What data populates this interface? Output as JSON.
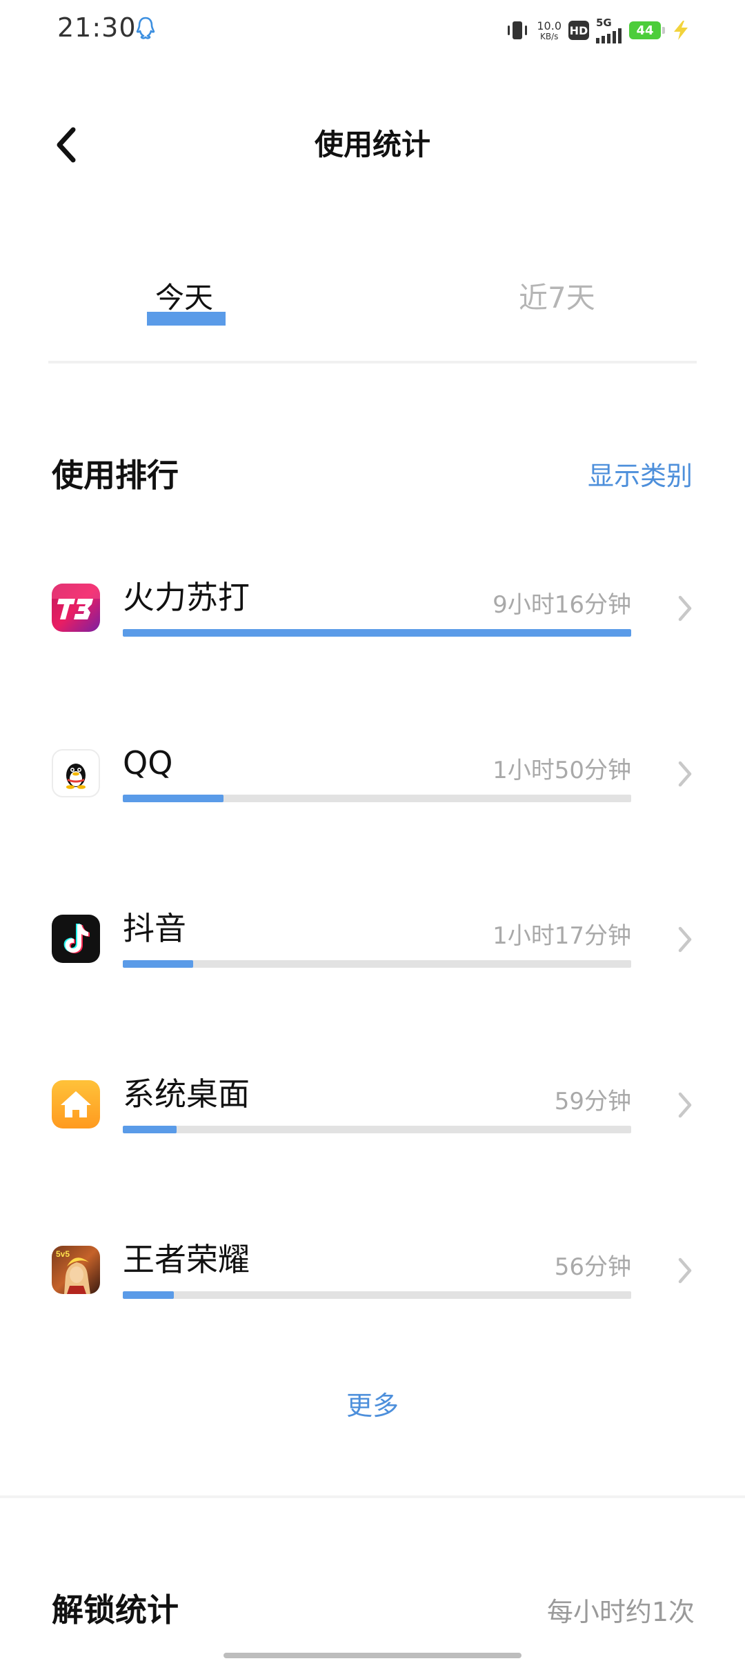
{
  "status_bar": {
    "time": "21:30",
    "net_speed_value": "10.0",
    "net_speed_unit": "KB/s",
    "hd_label": "HD",
    "network_label": "5G",
    "battery_level": "44"
  },
  "header": {
    "title": "使用统计"
  },
  "tabs": [
    {
      "label": "今天",
      "active": true
    },
    {
      "label": "近7天",
      "active": false
    }
  ],
  "ranking": {
    "title": "使用排行",
    "show_category_label": "显示类别",
    "apps": [
      {
        "name": "火力苏打",
        "duration": "9小时16分钟",
        "usage_fraction": 1.0,
        "icon": "t3-game-icon"
      },
      {
        "name": "QQ",
        "duration": "1小时50分钟",
        "usage_fraction": 0.198,
        "icon": "qq-penguin-icon"
      },
      {
        "name": "抖音",
        "duration": "1小时17分钟",
        "usage_fraction": 0.139,
        "icon": "douyin-icon"
      },
      {
        "name": "系统桌面",
        "duration": "59分钟",
        "usage_fraction": 0.106,
        "icon": "home-launcher-icon"
      },
      {
        "name": "王者荣耀",
        "duration": "56分钟",
        "usage_fraction": 0.101,
        "icon": "honor-of-kings-icon"
      }
    ],
    "more_label": "更多"
  },
  "unlock": {
    "title": "解锁统计",
    "value": "每小时约1次"
  },
  "colors": {
    "accent": "#5a9be8",
    "link": "#4d8fdb",
    "track": "#e2e2e2",
    "muted_text": "#a9a9a9"
  }
}
